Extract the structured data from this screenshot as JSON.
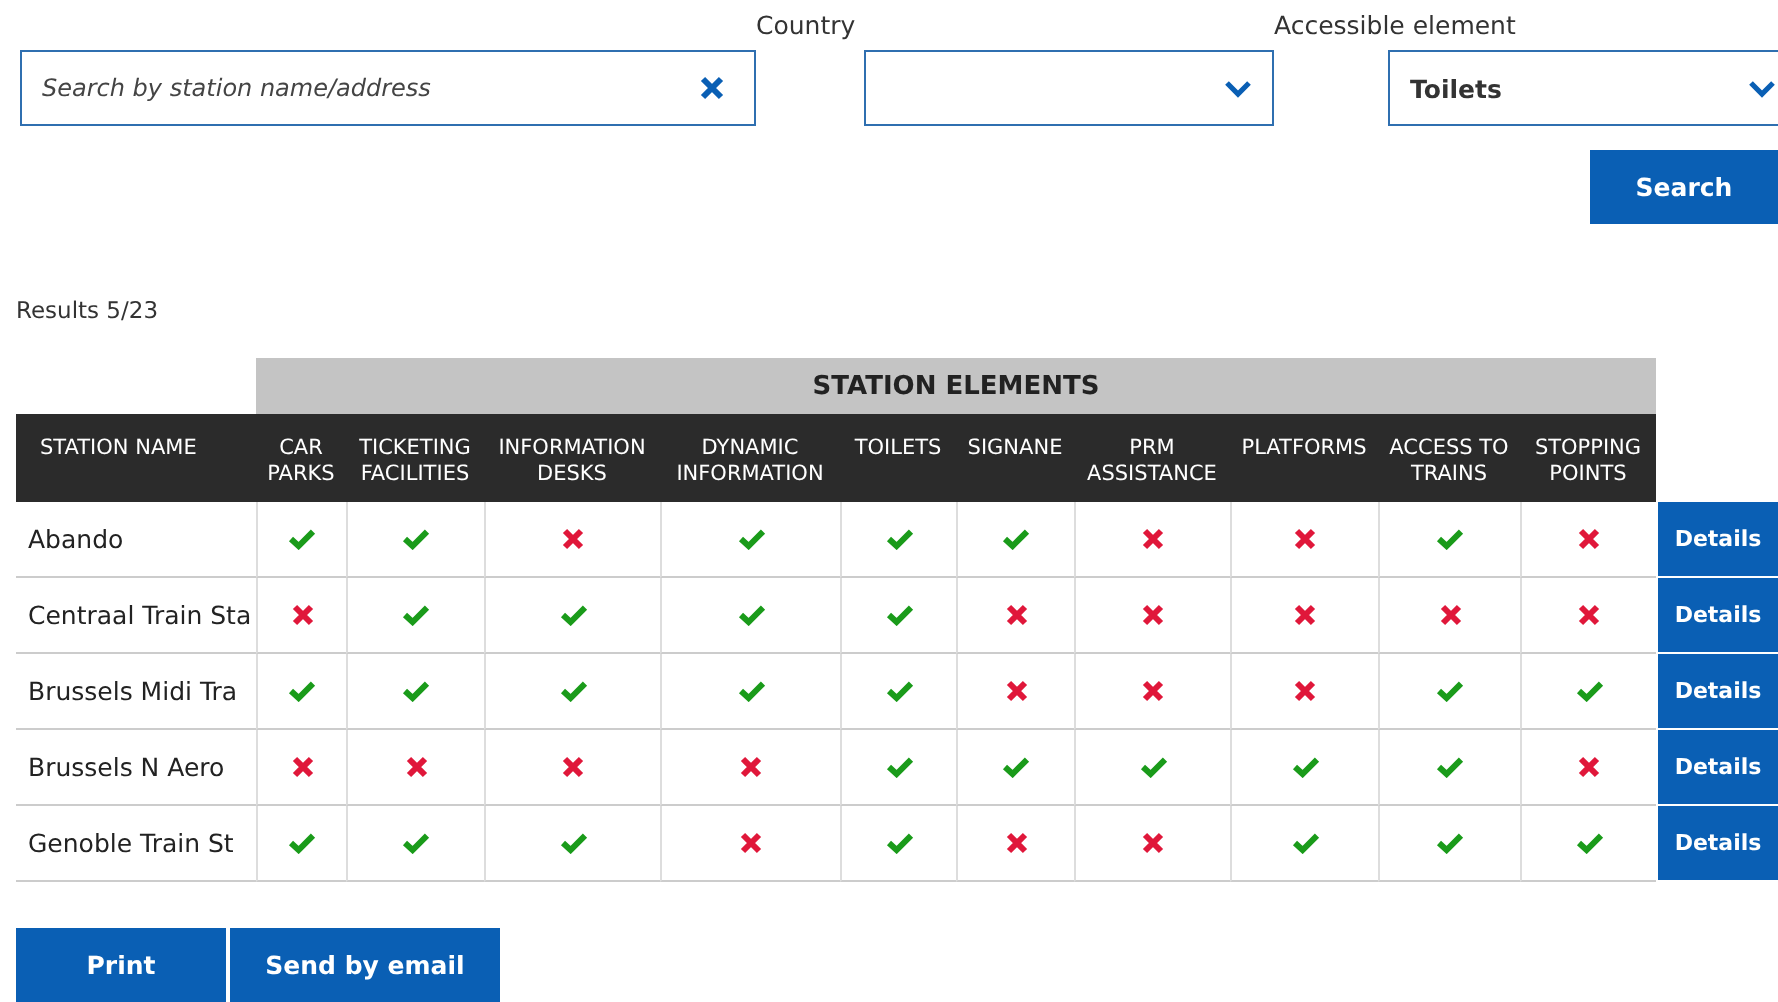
{
  "search": {
    "placeholder": "Search by station name/address"
  },
  "country": {
    "label": "Country"
  },
  "accessible_element": {
    "label": "Accessible element",
    "value": "Toilets"
  },
  "search_button": "Search",
  "results": "Results 5/23",
  "table": {
    "group_header": "STATION ELEMENTS",
    "columns": [
      "STATION NAME",
      "CAR PARKS",
      "TICKETING FACILITIES",
      "INFORMATION DESKS",
      "DYNAMIC INFORMATION",
      "TOILETS",
      "SIGNANE",
      "PRM ASSISTANCE",
      "PLATFORMS",
      "ACCESS TO TRAINS",
      "STOPPING POINTS"
    ],
    "rows": [
      {
        "station": "Abando",
        "elements": [
          true,
          true,
          false,
          true,
          true,
          true,
          false,
          false,
          true,
          false
        ],
        "action": "Details"
      },
      {
        "station": "Centraal Train Sta",
        "elements": [
          false,
          true,
          true,
          true,
          true,
          false,
          false,
          false,
          false,
          false
        ],
        "action": "Details"
      },
      {
        "station": "Brussels Midi Tra",
        "elements": [
          true,
          true,
          true,
          true,
          true,
          false,
          false,
          false,
          true,
          true
        ],
        "action": "Details"
      },
      {
        "station": "Brussels N Aero",
        "elements": [
          false,
          false,
          false,
          false,
          true,
          true,
          true,
          true,
          true,
          false
        ],
        "action": "Details"
      },
      {
        "station": "Genoble Train St",
        "elements": [
          true,
          true,
          true,
          false,
          true,
          false,
          false,
          true,
          true,
          true
        ],
        "action": "Details"
      }
    ]
  },
  "buttons": [
    "Print",
    "Send by email"
  ]
}
